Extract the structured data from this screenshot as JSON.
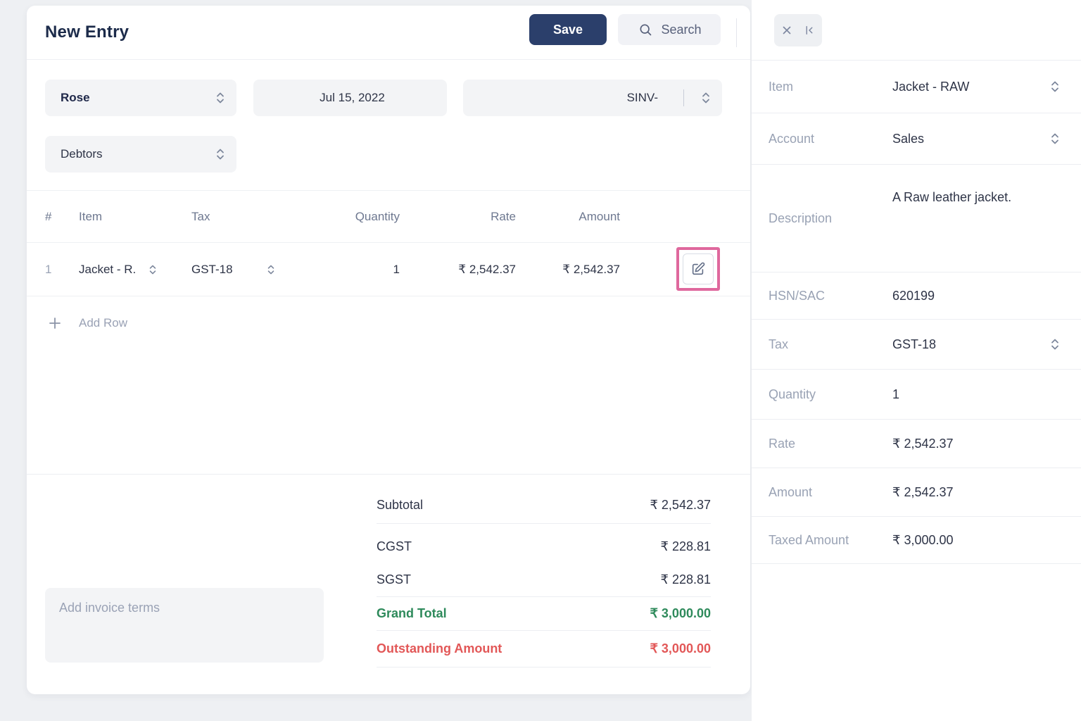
{
  "header": {
    "title": "New Entry",
    "save_label": "Save",
    "search_label": "Search"
  },
  "form": {
    "party_value": "Rose",
    "date_value": "Jul 15, 2022",
    "series_value": "SINV-",
    "account_value": "Debtors"
  },
  "items_table": {
    "columns": {
      "hash": "#",
      "item": "Item",
      "tax": "Tax",
      "quantity": "Quantity",
      "rate": "Rate",
      "amount": "Amount"
    },
    "row": {
      "index": "1",
      "item": "Jacket - R.",
      "tax": "GST-18",
      "quantity": "1",
      "rate": "₹ 2,542.37",
      "amount": "₹ 2,542.37"
    },
    "add_row_label": "Add Row"
  },
  "terms": {
    "placeholder": "Add invoice terms"
  },
  "totals": {
    "subtotal_label": "Subtotal",
    "subtotal_value": "₹ 2,542.37",
    "cgst_label": "CGST",
    "cgst_value": "₹ 228.81",
    "sgst_label": "SGST",
    "sgst_value": "₹ 228.81",
    "grand_total_label": "Grand Total",
    "grand_total_value": "₹ 3,000.00",
    "outstanding_label": "Outstanding Amount",
    "outstanding_value": "₹ 3,000.00"
  },
  "detail_panel": {
    "rows": [
      {
        "label": "Item",
        "value": "Jacket - RAW"
      },
      {
        "label": "Account",
        "value": "Sales"
      },
      {
        "label": "Description",
        "value": "A Raw leather jacket."
      },
      {
        "label": "HSN/SAC",
        "value": "620199"
      },
      {
        "label": "Tax",
        "value": "GST-18"
      },
      {
        "label": "Quantity",
        "value": "1"
      },
      {
        "label": "Rate",
        "value": "₹ 2,542.37"
      },
      {
        "label": "Amount",
        "value": "₹ 2,542.37"
      },
      {
        "label": "Taxed Amount",
        "value": "₹ 3,000.00"
      }
    ]
  },
  "icons": {
    "search-icon": "magnifier",
    "close-icon": "x-cross",
    "collapse-panel-icon": "bar-with-left-chevron",
    "select-chevron-icon": "up-down-carets",
    "plus-icon": "plus",
    "edit-icon": "pencil-in-square",
    "text-cursor": "vertical-bar"
  },
  "colors": {
    "page_bg": "#eef0f3",
    "card_bg": "#ffffff",
    "field_bg": "#f3f4f6",
    "accent_navy": "#2b3f6b",
    "title_navy": "#1c2b4a",
    "label_gray": "#99a2b4",
    "grand_total_green": "#2e8a5b",
    "outstanding_red": "#e25757",
    "highlight_pink": "#df689d"
  }
}
